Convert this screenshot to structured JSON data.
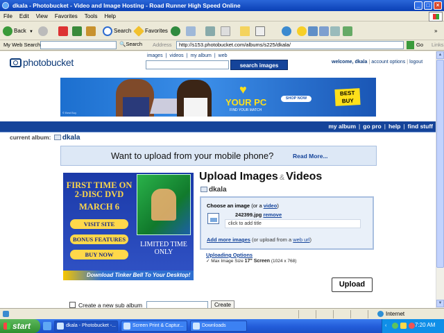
{
  "window": {
    "title": "dkala - Photobucket - Video and Image Hosting - Road Runner High Speed Online",
    "min_glyph": "_",
    "max_glyph": "□",
    "close_glyph": "×"
  },
  "menu": [
    "File",
    "Edit",
    "View",
    "Favorites",
    "Tools",
    "Help"
  ],
  "toolbar": {
    "back": "Back",
    "search": "Search",
    "favorites": "Favorites"
  },
  "address_row": {
    "websearch_label": "My Web Search",
    "search_btn": "Search",
    "address_label": "Address",
    "url": "http://s153.photobucket.com/albums/s225/dkala/",
    "go": "Go",
    "links": "Links"
  },
  "site": {
    "logo": "photobucket",
    "top_links": [
      "images",
      "videos",
      "my album",
      "web"
    ],
    "top_link_sep": "|",
    "search_button": "search images",
    "welcome": "welcome, dkala",
    "account_options": "account options",
    "logout": "logout",
    "nav": [
      "my album",
      "go pro",
      "help",
      "find stuff"
    ],
    "current_album_label": "current album:",
    "current_album_name": "dkala"
  },
  "banner_ad": {
    "headline": "YOUR PC",
    "sub": "FIND YOUR MATCH",
    "shop": "SHOP NOW",
    "brand": "BEST BUY",
    "copyright": "© Best Buy"
  },
  "mobile": {
    "text": "Want to upload from your mobile phone?",
    "read_more": "Read More..."
  },
  "pp_ad": {
    "line1": "FIRST TIME ON 2-DISC DVD",
    "line2": "MARCH 6",
    "visit": "VISIT SITE",
    "bonus": "BONUS FEATURES",
    "buy": "BUY NOW",
    "limited": "LIMITED TIME ONLY",
    "download": "Download Tinker Bell To Your Desktop!"
  },
  "upload": {
    "title_a": "Upload Images",
    "title_amp": "&",
    "title_b": "Videos",
    "album": "dkala",
    "choose": "Choose an image",
    "or_a": "(or a",
    "video": "video",
    "close_paren": ")",
    "file_name": "242399.jpg",
    "remove": "remove",
    "title_placeholder": "click to add title",
    "add_more": "Add more images",
    "or_upload": "(or upload from a",
    "web_url": "web url",
    "uploading_options": "Uploading Options",
    "max_prefix": "✓ Max Image Size",
    "max_screen": "17\" Screen",
    "max_dims": "(1024 x 768)",
    "upload_button": "Upload",
    "sub_album_label": "Create a new sub album",
    "create_button": "Create"
  },
  "status": {
    "zone": "Internet"
  },
  "taskbar": {
    "start": "start",
    "tasks": [
      "dkala - Photobucket -...",
      "Screen Print & Captur...",
      "Downloads"
    ],
    "clock": "7:20 AM"
  }
}
